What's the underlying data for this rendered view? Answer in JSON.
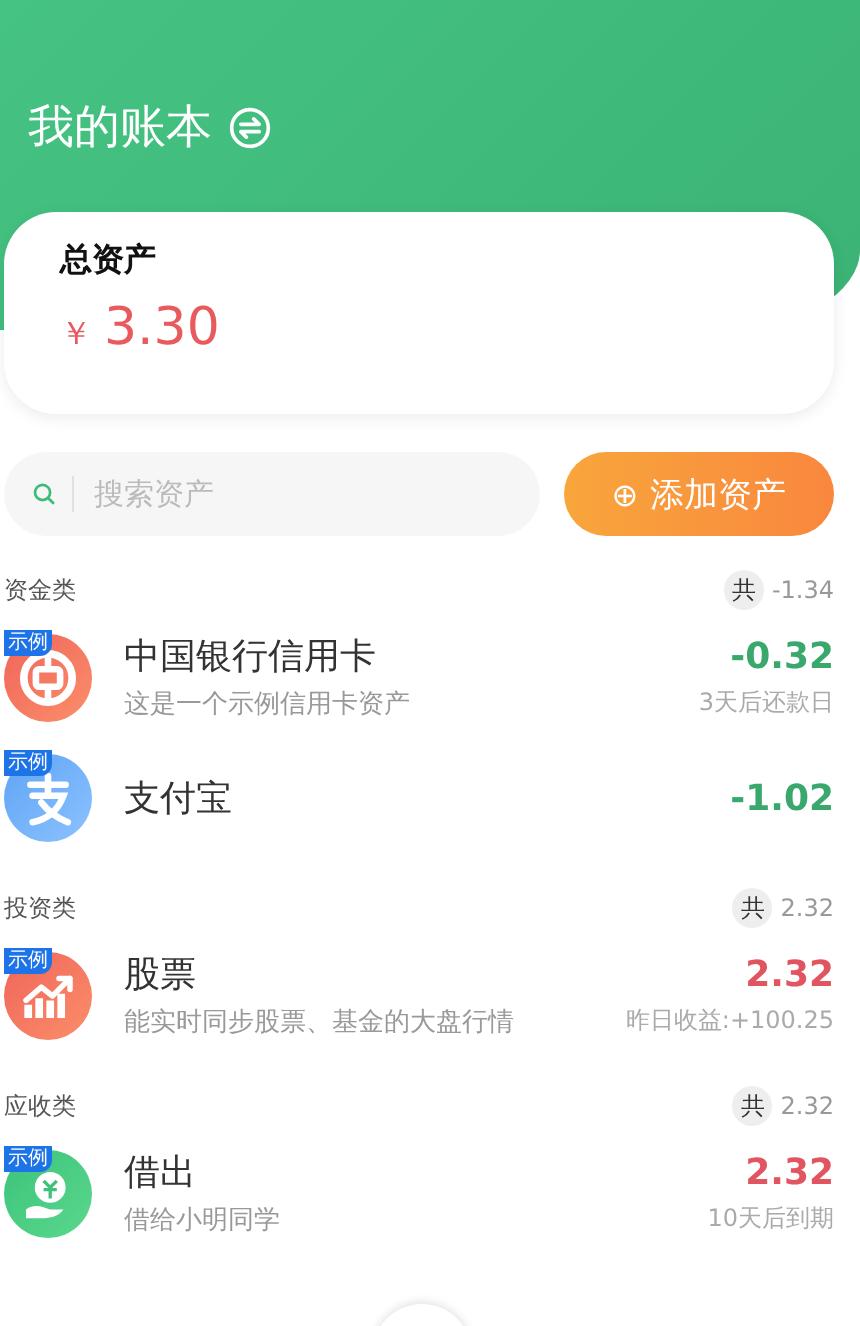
{
  "header": {
    "title": "我的账本"
  },
  "summary": {
    "label": "总资产",
    "currency": "￥",
    "amount": "3.30"
  },
  "search": {
    "placeholder": "搜索资产"
  },
  "add_button": {
    "icon": "⊕",
    "label": "添加资产"
  },
  "groups": [
    {
      "name": "资金类",
      "total_prefix": "共",
      "total": "-1.34",
      "items": [
        {
          "kind": "bank",
          "badge": "示例",
          "name": "中国银行信用卡",
          "note": "这是一个示例信用卡资产",
          "amount": "-0.32",
          "color": "#3aa86c",
          "detail": "3天后还款日"
        },
        {
          "kind": "alipay",
          "badge": "示例",
          "name": "支付宝",
          "amount": "-1.02",
          "color": "#3aa86c"
        }
      ]
    },
    {
      "name": "投资类",
      "total_prefix": "共",
      "total": "2.32",
      "items": [
        {
          "kind": "stock",
          "badge": "示例",
          "name": "股票",
          "note": "能实时同步股票、基金的大盘行情",
          "amount": "2.32",
          "color": "#e05560",
          "detail": "昨日收益:+100.25"
        }
      ]
    },
    {
      "name": "应收类",
      "total_prefix": "共",
      "total": "2.32",
      "items": [
        {
          "kind": "loan",
          "badge": "示例",
          "name": "借出",
          "note": "借给小明同学",
          "amount": "2.32",
          "color": "#e05560",
          "detail": "10天后到期"
        }
      ]
    }
  ]
}
